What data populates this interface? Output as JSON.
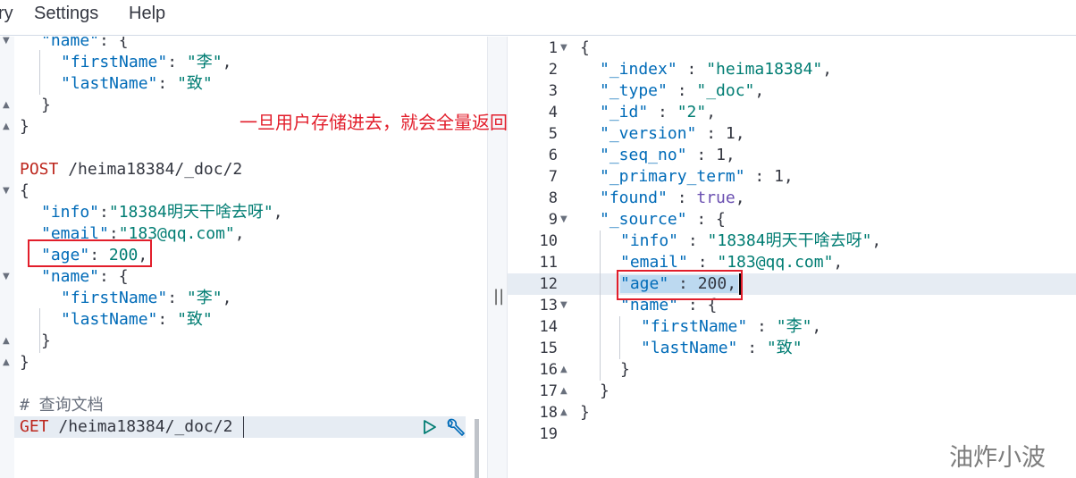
{
  "menu": {
    "items": [
      "ry",
      "Settings",
      "Help"
    ]
  },
  "annotation": "一旦用户存储进去，就会全量返回",
  "watermark": "油炸小波",
  "left_editor": {
    "request1_method": "POST",
    "request1_path": "/heima18384/_doc/2",
    "comment": "# 查询文档",
    "request2_method": "GET",
    "request2_path": "/heima18384/_doc/2",
    "name_key": "\"name\"",
    "firstName_key": "\"firstName\"",
    "firstName_val": "\"李\"",
    "lastName_key": "\"lastName\"",
    "lastName_val": "\"致\"",
    "info_key": "\"info\"",
    "info_val": "\"18384明天干啥去呀\"",
    "email_key": "\"email\"",
    "email_val": "\"183@qq.com\"",
    "age_key": "\"age\"",
    "age_val": "200"
  },
  "right_editor": {
    "line_numbers": [
      "1",
      "2",
      "3",
      "4",
      "5",
      "6",
      "7",
      "8",
      "9",
      "10",
      "11",
      "12",
      "13",
      "14",
      "15",
      "16",
      "17",
      "18",
      "19"
    ],
    "index_key": "\"_index\"",
    "index_val": "\"heima18384\"",
    "type_key": "\"_type\"",
    "type_val": "\"_doc\"",
    "id_key": "\"_id\"",
    "id_val": "\"2\"",
    "version_key": "\"_version\"",
    "version_val": "1",
    "seq_key": "\"_seq_no\"",
    "seq_val": "1",
    "term_key": "\"_primary_term\"",
    "term_val": "1",
    "found_key": "\"found\"",
    "found_val": "true",
    "source_key": "\"_source\"",
    "info_key": "\"info\"",
    "info_val": "\"18384明天干啥去呀\"",
    "email_key": "\"email\"",
    "email_val": "\"183@qq.com\"",
    "age_key": "\"age\"",
    "age_val": "200",
    "name_key": "\"name\"",
    "firstName_key": "\"firstName\"",
    "firstName_val": "\"李\"",
    "lastName_key": "\"lastName\"",
    "lastName_val": "\"致\""
  },
  "icons": [
    "play-icon",
    "wrench-icon",
    "fold-arrow-icon"
  ],
  "colors": {
    "key": "#006bb8",
    "string": "#017d73",
    "method": "#bd271e",
    "bool": "#6a4fb1",
    "annotation": "#e21e2b"
  }
}
